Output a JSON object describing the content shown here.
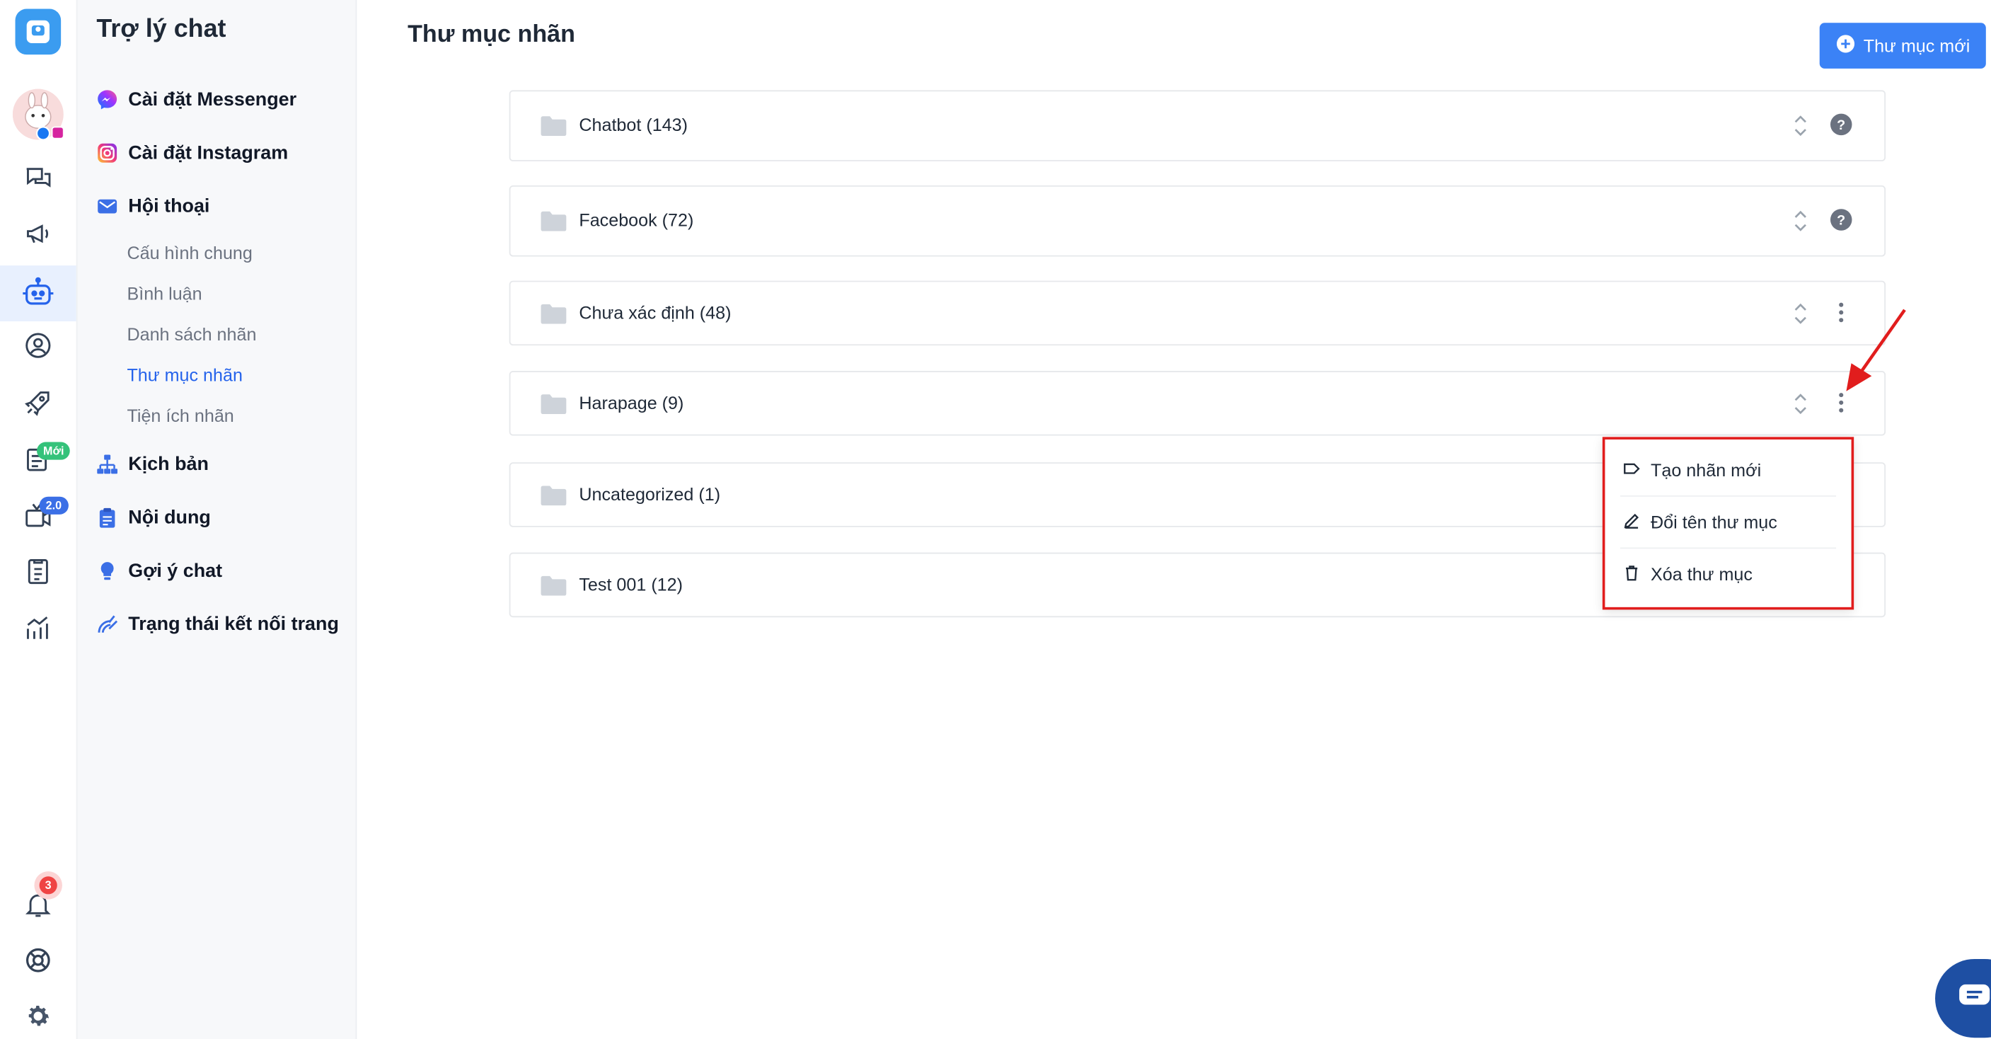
{
  "rail": {
    "items": [
      "app-logo",
      "account-avatar",
      "chat",
      "campaign",
      "chatbot",
      "customers",
      "growth",
      "posts",
      "livestream",
      "orders",
      "reports",
      "notifications",
      "support",
      "settings"
    ],
    "new_badge": "Mới",
    "version_badge": "2.0",
    "notification_count": "3"
  },
  "sidebar": {
    "title": "Trợ lý chat",
    "items": [
      {
        "label": "Cài đặt Messenger",
        "icon": "messenger-icon"
      },
      {
        "label": "Cài đặt Instagram",
        "icon": "instagram-icon"
      },
      {
        "label": "Hội thoại",
        "icon": "mail-icon"
      },
      {
        "label": "Kịch bản",
        "icon": "flow-icon"
      },
      {
        "label": "Nội dung",
        "icon": "clipboard-icon"
      },
      {
        "label": "Gợi ý chat",
        "icon": "bulb-icon"
      },
      {
        "label": "Trạng thái kết nối trang",
        "icon": "signal-icon"
      }
    ],
    "sub_items": [
      "Cấu hình chung",
      "Bình luận",
      "Danh sách nhãn",
      "Thư mục nhãn",
      "Tiện ích nhãn"
    ],
    "active_sub": "Thư mục nhãn"
  },
  "main": {
    "title": "Thư mục nhãn",
    "new_folder_button": "Thư mục mới",
    "folders": [
      {
        "label": "Chatbot (143)",
        "action": "help-icon"
      },
      {
        "label": "Facebook (72)",
        "action": "help-icon"
      },
      {
        "label": "Chưa xác định (48)",
        "action": "more-icon"
      },
      {
        "label": "Harapage (9)",
        "action": "more-icon"
      },
      {
        "label": "Uncategorized (1)",
        "action": "none"
      },
      {
        "label": "Test 001 (12)",
        "action": "none"
      }
    ]
  },
  "menu": {
    "items": [
      {
        "label": "Tạo nhãn mới",
        "icon": "tag-icon"
      },
      {
        "label": "Đổi tên thư mục",
        "icon": "pencil-icon"
      },
      {
        "label": "Xóa thư mục",
        "icon": "trash-icon"
      }
    ]
  },
  "colors": {
    "accent": "#3b82f6",
    "active_link": "#2563eb",
    "highlight_border": "#e11d1d",
    "arrow": "#e11d1d"
  }
}
